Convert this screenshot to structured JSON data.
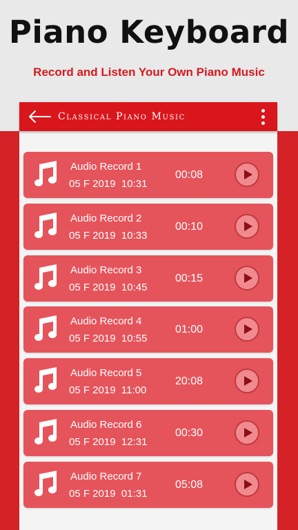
{
  "promo": {
    "title": "Piano Keyboard",
    "subtitle": "Record and Listen Your Own Piano Music"
  },
  "appbar": {
    "title": "Classical Piano Music",
    "back_icon": "arrow-left-icon",
    "menu_icon": "more-vert-icon"
  },
  "colors": {
    "accent": "#d9161c",
    "item_bg": "#e5545b",
    "subtitle": "#d7191f"
  },
  "recordings": [
    {
      "name": "Audio Record 1",
      "date": "05 F 2019  10:31",
      "duration": "00:08"
    },
    {
      "name": "Audio Record 2",
      "date": "05 F 2019  10:33",
      "duration": "00:10"
    },
    {
      "name": "Audio Record 3",
      "date": "05 F 2019  10:45",
      "duration": "00:15"
    },
    {
      "name": "Audio Record 4",
      "date": "05 F 2019  10:55",
      "duration": "01:00"
    },
    {
      "name": "Audio Record 5",
      "date": "05 F 2019  11:00",
      "duration": "20:08"
    },
    {
      "name": "Audio Record 6",
      "date": "05 F 2019  12:31",
      "duration": "00:30"
    },
    {
      "name": "Audio Record 7",
      "date": "05 F 2019  01:31",
      "duration": "05:08"
    }
  ]
}
